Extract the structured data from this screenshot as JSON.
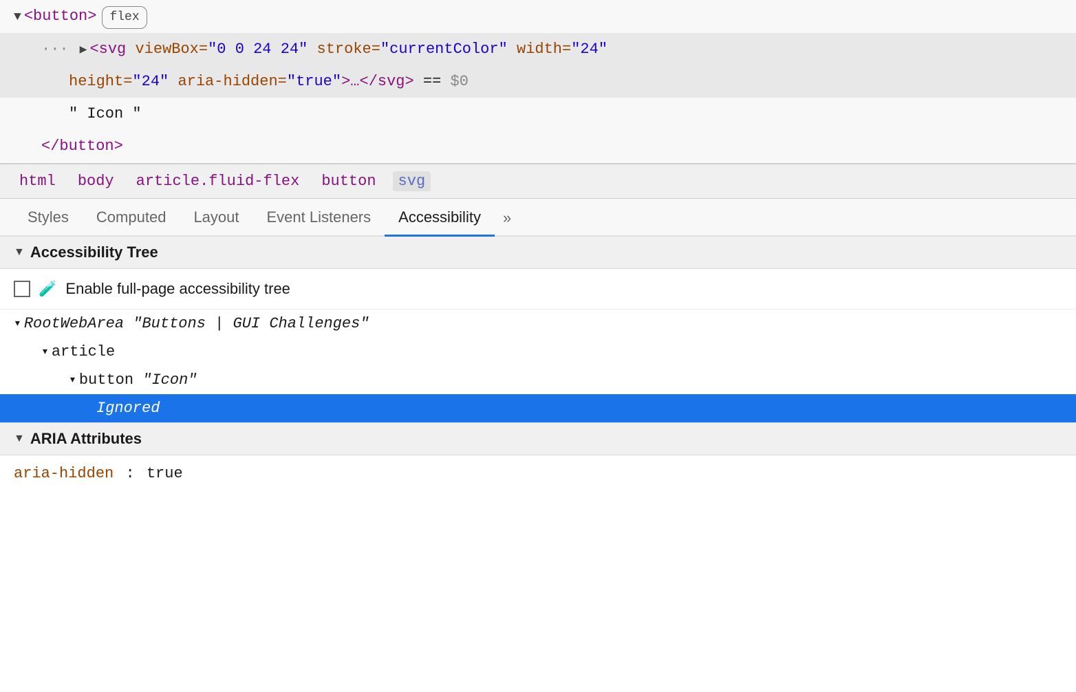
{
  "dom_inspector": {
    "lines": [
      {
        "id": "line1",
        "indent": "dom-indent-0",
        "selected": false,
        "has_ellipsis": false,
        "content_html": "button_open_flex"
      },
      {
        "id": "line2",
        "indent": "dom-indent-1",
        "selected": true,
        "has_ellipsis": true,
        "content_html": "svg_tag"
      },
      {
        "id": "line3",
        "indent": "dom-indent-2",
        "selected": false,
        "has_ellipsis": false,
        "content_html": "text_node_icon"
      },
      {
        "id": "line4",
        "indent": "dom-indent-1",
        "selected": false,
        "has_ellipsis": false,
        "content_html": "button_close"
      }
    ]
  },
  "breadcrumb": {
    "items": [
      {
        "label": "html",
        "active": false
      },
      {
        "label": "body",
        "active": false
      },
      {
        "label": "article.fluid-flex",
        "active": false
      },
      {
        "label": "button",
        "active": false
      },
      {
        "label": "svg",
        "active": true
      }
    ]
  },
  "tabs": {
    "items": [
      {
        "label": "Styles",
        "active": false
      },
      {
        "label": "Computed",
        "active": false
      },
      {
        "label": "Layout",
        "active": false
      },
      {
        "label": "Event Listeners",
        "active": false
      },
      {
        "label": "Accessibility",
        "active": true
      }
    ],
    "more_label": "»"
  },
  "accessibility": {
    "section_title": "Accessibility Tree",
    "enable_label": "Enable full-page accessibility tree",
    "tree_nodes": [
      {
        "id": "root",
        "indent": 0,
        "chevron": "▾",
        "text_italic": "RootWebArea",
        "text_quoted": " \"Buttons | GUI Challenges\"",
        "highlighted": false
      },
      {
        "id": "article",
        "indent": 1,
        "chevron": "▾",
        "text_plain": "article",
        "highlighted": false
      },
      {
        "id": "button",
        "indent": 2,
        "chevron": "▾",
        "text_plain": "button",
        "text_quoted": " \"Icon\"",
        "highlighted": false
      },
      {
        "id": "ignored",
        "indent": 3,
        "chevron": "",
        "text_italic": "Ignored",
        "highlighted": true
      }
    ]
  },
  "aria": {
    "section_title": "ARIA Attributes",
    "attributes": [
      {
        "name": "aria-hidden",
        "value": "true"
      }
    ]
  },
  "colors": {
    "active_tab_underline": "#1a73e8",
    "highlighted_row_bg": "#1a73e8",
    "tag_color": "#881280",
    "attr_name_color": "#994500",
    "string_color": "#1c00cf"
  }
}
